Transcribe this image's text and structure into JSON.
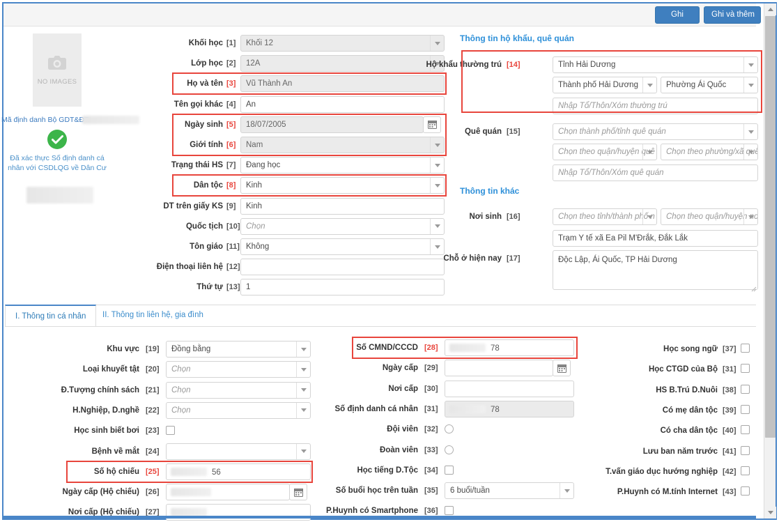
{
  "toolbar": {
    "save_label": "Ghi",
    "save_add_label": "Ghi và thêm"
  },
  "photo_panel": {
    "no_image_text": "NO IMAGES",
    "id_label": "Mã định danh Bộ GDT&ĐT:",
    "verified_text": "Đã xác thực Số định danh cá nhân với CSDLQG về Dân Cư"
  },
  "sections": {
    "household": "Thông tin hộ khẩu, quê quán",
    "other": "Thông tin khác"
  },
  "tabs": [
    {
      "label": "I. Thông tin cá nhân",
      "active": true
    },
    {
      "label": "II. Thông tin liên hệ, gia đình",
      "active": false
    }
  ],
  "main_fields": [
    {
      "num": "[1]",
      "label": "Khối học",
      "value": "Khối 12",
      "type": "select",
      "state": "disabled",
      "highlight": false
    },
    {
      "num": "[2]",
      "label": "Lớp học",
      "value": "12A",
      "type": "select",
      "state": "disabled",
      "highlight": false
    },
    {
      "num": "[3]",
      "label": "Họ và tên",
      "value": "Vũ Thành An",
      "type": "text",
      "state": "disabled",
      "highlight": true
    },
    {
      "num": "[4]",
      "label": "Tên gọi khác",
      "value": "An",
      "type": "text",
      "state": "normal",
      "highlight": false
    },
    {
      "num": "[5]",
      "label": "Ngày sinh",
      "value": "18/07/2005",
      "type": "date",
      "state": "disabled",
      "highlight": true
    },
    {
      "num": "[6]",
      "label": "Giới tính",
      "value": "Nam",
      "type": "select",
      "state": "disabled",
      "highlight": true
    },
    {
      "num": "[7]",
      "label": "Trạng thái HS",
      "value": "Đang học",
      "type": "select",
      "state": "normal",
      "highlight": false
    },
    {
      "num": "[8]",
      "label": "Dân tộc",
      "value": "Kinh",
      "type": "select",
      "state": "normal",
      "highlight": true
    },
    {
      "num": "[9]",
      "label": "DT trên giấy KS",
      "value": "Kinh",
      "type": "text",
      "state": "normal",
      "highlight": false
    },
    {
      "num": "[10]",
      "label": "Quốc tịch",
      "value": "Chọn",
      "type": "select",
      "state": "placeholder",
      "highlight": false
    },
    {
      "num": "[11]",
      "label": "Tôn giáo",
      "value": "Không",
      "type": "select",
      "state": "normal",
      "highlight": false
    },
    {
      "num": "[12]",
      "label": "Điện thoại liên hệ",
      "value": "",
      "type": "text",
      "state": "normal",
      "highlight": false
    },
    {
      "num": "[13]",
      "label": "Thứ tự",
      "value": "1",
      "type": "text",
      "state": "normal",
      "highlight": false
    }
  ],
  "household_fields": {
    "permanent": {
      "num": "[14]",
      "label": "Hộ khẩu thường trú",
      "province": "Tỉnh Hải Dương",
      "district": "Thành phố Hải Dương",
      "ward": "Phường Ái Quốc",
      "street_placeholder": "Nhập Tổ/Thôn/Xóm thường trú"
    },
    "hometown": {
      "num": "[15]",
      "label": "Quê quán",
      "province_placeholder": "Chọn thành phố/tỉnh quê quán",
      "district_placeholder": "Chọn theo quận/huyện quê",
      "ward_placeholder": "Chọn theo phường/xã quê",
      "street_placeholder": "Nhập Tổ/Thôn/Xóm quê quán"
    }
  },
  "other_fields": {
    "birthplace": {
      "num": "[16]",
      "label": "Nơi sinh",
      "province_placeholder": "Chọn theo tỉnh/thành phố n",
      "district_placeholder": "Chọn theo quận/huyện nơi",
      "detail": "Trạm Y tế xã Ea Pil M'Đrắk, Đắk Lắk"
    },
    "current_address": {
      "num": "[17]",
      "label": "Chỗ ở hiện nay",
      "value": "Độc Lập, Ái Quốc, TP Hải Dương"
    }
  },
  "tab_left_fields": [
    {
      "num": "[19]",
      "label": "Khu vực",
      "value": "Đồng bằng",
      "type": "select",
      "state": "normal",
      "highlight": false
    },
    {
      "num": "[20]",
      "label": "Loại khuyết tật",
      "value": "Chọn",
      "type": "select",
      "state": "placeholder",
      "highlight": false
    },
    {
      "num": "[21]",
      "label": "Đ.Tượng chính sách",
      "value": "Chọn",
      "type": "select",
      "state": "placeholder",
      "highlight": false
    },
    {
      "num": "[22]",
      "label": "H.Nghiệp, D.nghề",
      "value": "Chọn",
      "type": "select",
      "state": "placeholder",
      "highlight": false
    },
    {
      "num": "[23]",
      "label": "Học sinh biết bơi",
      "value": "",
      "type": "checkbox",
      "state": "normal",
      "highlight": false
    },
    {
      "num": "[24]",
      "label": "Bệnh về mắt",
      "value": "",
      "type": "select",
      "state": "normal",
      "highlight": false
    },
    {
      "num": "[25]",
      "label": "Số hộ chiếu",
      "value": "56",
      "type": "redacted",
      "state": "normal",
      "highlight": true
    },
    {
      "num": "[26]",
      "label": "Ngày cấp (Hộ chiếu)",
      "value": "",
      "type": "redacted-date",
      "state": "normal",
      "highlight": false
    },
    {
      "num": "[27]",
      "label": "Nơi cấp (Hộ chiếu)",
      "value": "",
      "type": "redacted",
      "state": "normal",
      "highlight": false
    }
  ],
  "tab_mid_fields": [
    {
      "num": "[28]",
      "label": "Số CMND/CCCD",
      "value": "78",
      "type": "redacted",
      "state": "normal",
      "highlight": true
    },
    {
      "num": "[29]",
      "label": "Ngày cấp",
      "value": "",
      "type": "date",
      "state": "normal",
      "highlight": false
    },
    {
      "num": "[30]",
      "label": "Nơi cấp",
      "value": "",
      "type": "text",
      "state": "normal",
      "highlight": false
    },
    {
      "num": "[31]",
      "label": "Số định danh cá nhân",
      "value": "78",
      "type": "redacted",
      "state": "disabled",
      "highlight": false
    },
    {
      "num": "[32]",
      "label": "Đội viên",
      "value": "",
      "type": "radio",
      "state": "normal",
      "highlight": false
    },
    {
      "num": "[33]",
      "label": "Đoàn viên",
      "value": "",
      "type": "radio",
      "state": "normal",
      "highlight": false
    },
    {
      "num": "[34]",
      "label": "Học tiếng D.Tộc",
      "value": "",
      "type": "checkbox",
      "state": "normal",
      "highlight": false
    },
    {
      "num": "[35]",
      "label": "Số buổi học trên tuần",
      "value": "6 buổi/tuần",
      "type": "select",
      "state": "normal",
      "highlight": false
    },
    {
      "num": "[36]",
      "label": "P.Huynh có Smartphone",
      "value": "",
      "type": "checkbox",
      "state": "normal",
      "highlight": false
    }
  ],
  "tab_right_fields": [
    {
      "num": "[37]",
      "label": "Học song ngữ",
      "type": "checkbox"
    },
    {
      "num": "[31]",
      "label": "Học CTGD của Bộ",
      "type": "checkbox"
    },
    {
      "num": "[38]",
      "label": "HS B.Trú D.Nuôi",
      "type": "checkbox"
    },
    {
      "num": "[39]",
      "label": "Có mẹ dân tộc",
      "type": "checkbox"
    },
    {
      "num": "[40]",
      "label": "Có cha dân tộc",
      "type": "checkbox"
    },
    {
      "num": "[41]",
      "label": "Lưu ban năm trước",
      "type": "checkbox"
    },
    {
      "num": "[42]",
      "label": "T.vấn giáo dục hướng nghiệp",
      "type": "checkbox"
    },
    {
      "num": "[43]",
      "label": "P.Huynh có M.tính Internet",
      "type": "checkbox"
    }
  ],
  "colors": {
    "accent_blue": "#3f7fbf",
    "section_blue": "#2e90d9",
    "highlight_red": "#e8453c",
    "verified_green": "#3cb54a"
  }
}
